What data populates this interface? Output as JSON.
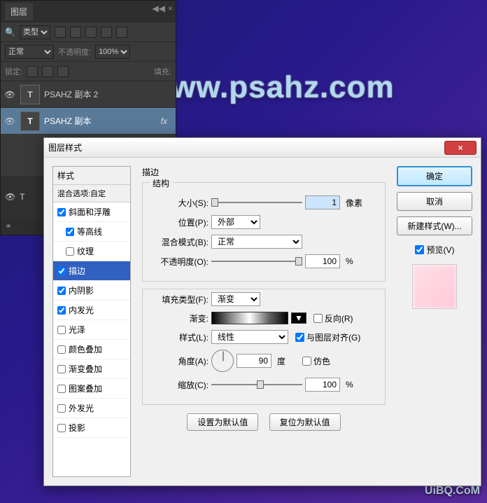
{
  "watermark_main": "www.psahz.com",
  "watermark_corner": "UiBQ.CoM",
  "layers_panel": {
    "tab": "图层",
    "kind_label": "类型",
    "blend_mode": "正常",
    "opacity_label": "不透明度:",
    "opacity_value": "100%",
    "lock_label": "锁定:",
    "fill_label": "填充:",
    "layer1": "PSAHZ 副本 2",
    "layer2": "PSAHZ 副本",
    "fx": "fx",
    "type_glyph": "T"
  },
  "dialog": {
    "title": "图层样式",
    "close_glyph": "×",
    "styles_header": "样式",
    "blend_options": "混合选项:自定",
    "styles": {
      "bevel": "斜面和浮雕",
      "contour": "等高线",
      "texture": "纹理",
      "stroke": "描边",
      "inner_shadow": "内阴影",
      "inner_glow": "内发光",
      "satin": "光泽",
      "color_overlay": "颜色叠加",
      "gradient_overlay": "渐变叠加",
      "pattern_overlay": "图案叠加",
      "outer_glow": "外发光",
      "drop_shadow": "投影"
    },
    "content": {
      "section_title": "描边",
      "structure": "结构",
      "size_label": "大小(S):",
      "size_value": "1",
      "size_unit": "像素",
      "position_label": "位置(P):",
      "position_value": "外部",
      "blend_label": "混合模式(B):",
      "blend_value": "正常",
      "opacity_label": "不透明度(O):",
      "opacity_value": "100",
      "opacity_unit": "%",
      "fill_type_label": "填充类型(F):",
      "fill_type_value": "渐变",
      "gradient_label": "渐变:",
      "reverse_label": "反向(R)",
      "style_label": "样式(L):",
      "style_value": "线性",
      "align_label": "与图层对齐(G)",
      "angle_label": "角度(A):",
      "angle_value": "90",
      "angle_unit": "度",
      "dither_label": "仿色",
      "scale_label": "缩放(C):",
      "scale_value": "100",
      "scale_unit": "%",
      "set_default": "设置为默认值",
      "reset_default": "复位为默认值"
    },
    "right": {
      "ok": "确定",
      "cancel": "取消",
      "new_style": "新建样式(W)...",
      "preview": "预览(V)"
    }
  }
}
